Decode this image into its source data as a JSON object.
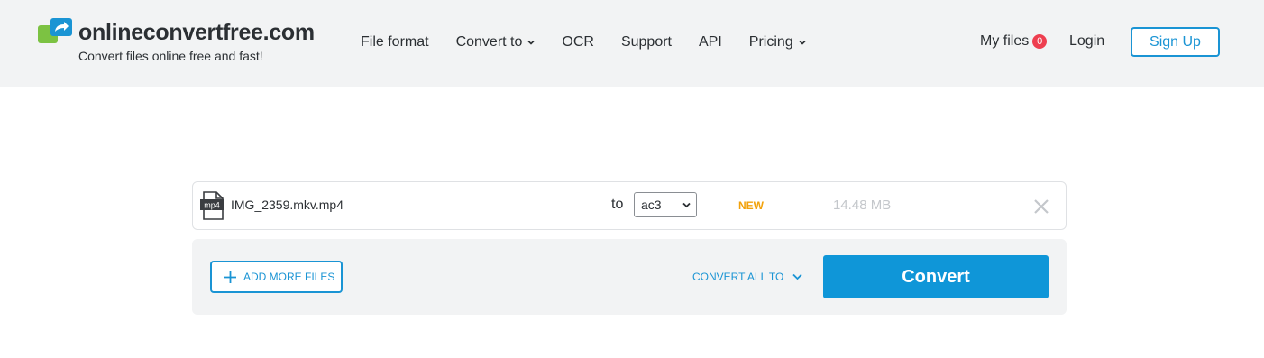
{
  "header": {
    "logo_title": "onlineconvertfree.com",
    "logo_tagline": "Convert files online free and fast!",
    "nav": [
      {
        "label": "File format",
        "has_dropdown": false
      },
      {
        "label": "Convert to",
        "has_dropdown": true
      },
      {
        "label": "OCR",
        "has_dropdown": false
      },
      {
        "label": "Support",
        "has_dropdown": false
      },
      {
        "label": "API",
        "has_dropdown": false
      },
      {
        "label": "Pricing",
        "has_dropdown": true
      }
    ],
    "my_files_label": "My files",
    "my_files_count": "0",
    "login_label": "Login",
    "signup_label": "Sign Up"
  },
  "file": {
    "type_label": "mp4",
    "name": "IMG_2359.mkv.mp4",
    "to_label": "to",
    "target_format": "ac3",
    "new_label": "NEW",
    "size": "14.48 MB"
  },
  "actions": {
    "add_more_label": "ADD MORE FILES",
    "convert_all_label": "CONVERT ALL TO",
    "convert_label": "Convert"
  },
  "colors": {
    "accent": "#1a94d4",
    "convert_button": "#0f96d8",
    "badge": "#ee3e4f",
    "new": "#f2a20c",
    "header_bg": "#f2f3f4"
  },
  "icons": {
    "logo": "arrow-convert-icon",
    "file": "document-icon",
    "remove": "close-icon",
    "add": "plus-icon",
    "dropdown": "chevron-down-icon"
  }
}
